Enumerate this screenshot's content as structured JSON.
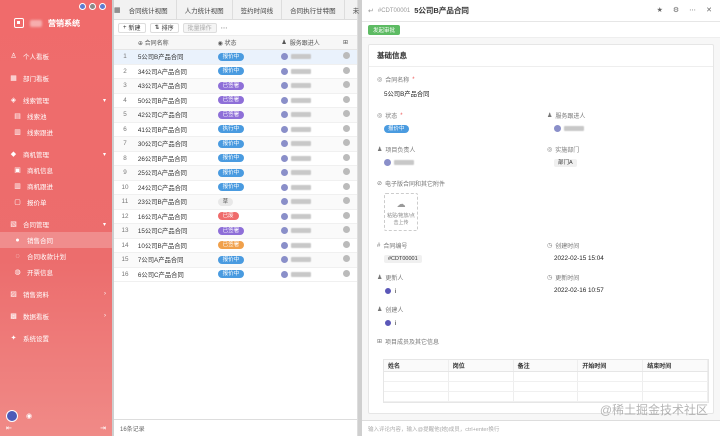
{
  "sidebar": {
    "brand": "营销系统",
    "items": [
      {
        "label": "个人看板",
        "icon": "user-icon",
        "level": 0
      },
      {
        "label": "部门看板",
        "icon": "dashboard-icon",
        "level": 0
      },
      {
        "label": "线索管理",
        "icon": "lead-icon",
        "level": 0,
        "expanded": true
      },
      {
        "label": "线索池",
        "icon": "pool-icon",
        "level": 1
      },
      {
        "label": "线索跟进",
        "icon": "follow-icon",
        "level": 1
      },
      {
        "label": "商机管理",
        "icon": "opportunity-icon",
        "level": 0,
        "expanded": true
      },
      {
        "label": "商机信息",
        "icon": "info-icon",
        "level": 1
      },
      {
        "label": "商机跟进",
        "icon": "follow-icon",
        "level": 1
      },
      {
        "label": "报价单",
        "icon": "quote-icon",
        "level": 1
      },
      {
        "label": "合同管理",
        "icon": "contract-icon",
        "level": 0,
        "expanded": true
      },
      {
        "label": "销售合同",
        "icon": "dot-icon",
        "level": 1,
        "active": true
      },
      {
        "label": "合同收款计划",
        "icon": "plan-icon",
        "level": 1
      },
      {
        "label": "开票信息",
        "icon": "invoice-icon",
        "level": 1
      },
      {
        "label": "销售资料",
        "icon": "doc-icon",
        "level": 0
      },
      {
        "label": "数据看板",
        "icon": "chart-icon",
        "level": 0
      },
      {
        "label": "系统设置",
        "icon": "settings-icon",
        "level": 0
      }
    ]
  },
  "tabs": [
    "合同统计视图",
    "人力统计视图",
    "签约时间线",
    "合同执行甘特图",
    "未"
  ],
  "toolbar": {
    "new": "新建",
    "sort": "排序",
    "batch": "批量操作",
    "more": "⋯"
  },
  "grid": {
    "headers": {
      "name": "合同名称",
      "status": "状态",
      "owner": "服务跟进人"
    },
    "rows": [
      {
        "num": "1",
        "name": "5公司B产品合同",
        "status": "报价中",
        "color": "#4a9be0"
      },
      {
        "num": "2",
        "name": "34公司A产品合同",
        "status": "报价中",
        "color": "#4a9be0"
      },
      {
        "num": "3",
        "name": "43公司A产品合同",
        "status": "已签署",
        "color": "#8e6fd8"
      },
      {
        "num": "4",
        "name": "50公司B产品合同",
        "status": "已签署",
        "color": "#8e6fd8"
      },
      {
        "num": "5",
        "name": "42公司C产品合同",
        "status": "已签署",
        "color": "#8e6fd8"
      },
      {
        "num": "6",
        "name": "41公司B产品合同",
        "status": "执行中",
        "color": "#4a9be0"
      },
      {
        "num": "7",
        "name": "30公司C产品合同",
        "status": "报价中",
        "color": "#4a9be0"
      },
      {
        "num": "8",
        "name": "26公司B产品合同",
        "status": "报价中",
        "color": "#4a9be0"
      },
      {
        "num": "9",
        "name": "25公司A产品合同",
        "status": "报价中",
        "color": "#4a9be0"
      },
      {
        "num": "10",
        "name": "24公司C产品合同",
        "status": "报价中",
        "color": "#4a9be0"
      },
      {
        "num": "11",
        "name": "23公司B产品合同",
        "status": "草",
        "color": "#e8e8e8"
      },
      {
        "num": "12",
        "name": "16公司A产品合同",
        "status": "已废",
        "color": "#ef6b6b"
      },
      {
        "num": "13",
        "name": "15公司C产品合同",
        "status": "已签署",
        "color": "#8e6fd8"
      },
      {
        "num": "14",
        "name": "10公司B产品合同",
        "status": "已签署",
        "color": "#f0a04b"
      },
      {
        "num": "15",
        "name": "7公司A产品合同",
        "status": "报价中",
        "color": "#4a9be0"
      },
      {
        "num": "16",
        "name": "6公司C产品合同",
        "status": "报价中",
        "color": "#4a9be0"
      }
    ],
    "footer": "16条记录"
  },
  "detail": {
    "code": "#CDT00001",
    "title": "5公司B产品合同",
    "action_btn": "发起审批",
    "section": "基础信息",
    "fields": {
      "name_label": "合同名称",
      "name_value": "5公司B产品合同",
      "status_label": "状态",
      "status_value": "报价中",
      "follower_label": "服务跟进人",
      "owner_label": "项目负责人",
      "dept_label": "实施部门",
      "dept_value": "部门A",
      "attach_label": "电子版合同和其它附件",
      "upload_text": "粘贴/拖放/点击上传",
      "number_label": "合同编号",
      "number_value": "#CDT00001",
      "created_label": "创建时间",
      "created_value": "2022-02-15 15:04",
      "updater_label": "更新人",
      "updated_label": "更新时间",
      "updated_value": "2022-02-16 10:57",
      "creator_label": "创建人",
      "detail_label": "项目成员及其它信息"
    },
    "sub_table_headers": [
      "姓名",
      "岗位",
      "备注",
      "开始时间",
      "结束时间"
    ],
    "footer_hint": "输入评论内容，输入@提醒他(她)成员，ctrl+enter换行"
  },
  "watermark": "@稀土掘金技术社区"
}
